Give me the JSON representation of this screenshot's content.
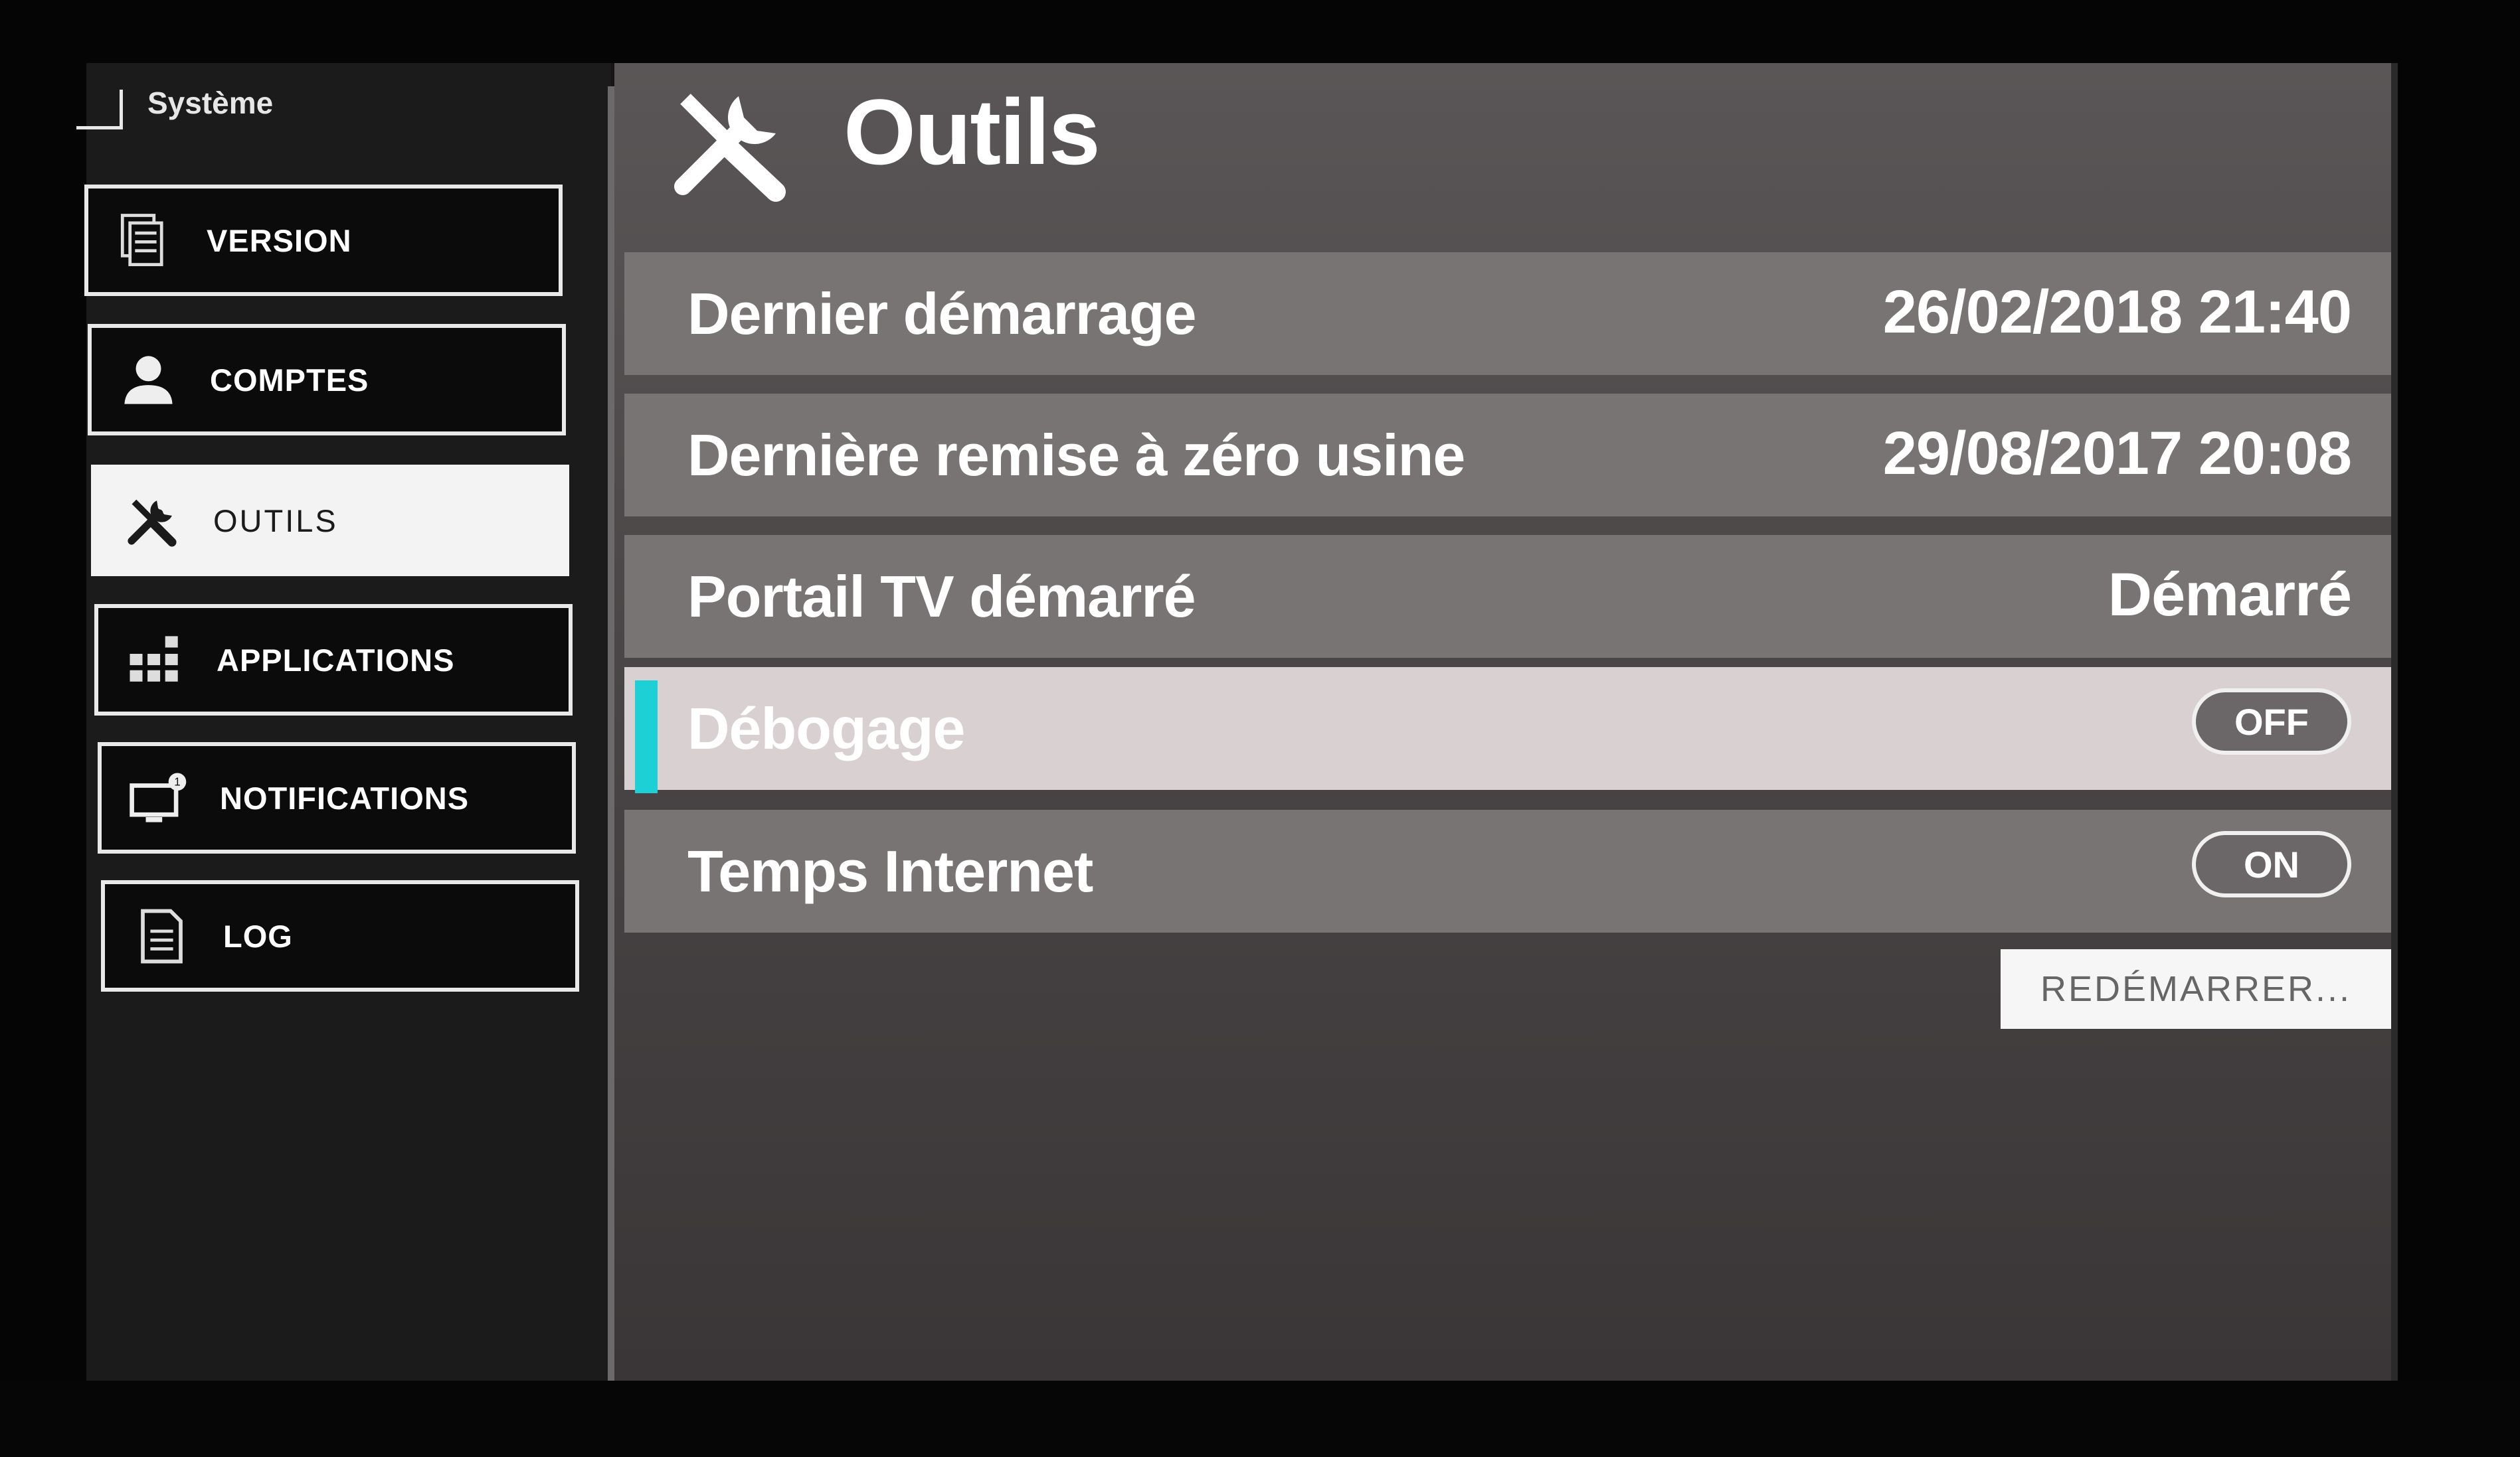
{
  "sidebar": {
    "section_title": "Système",
    "items": [
      {
        "label": "VERSION",
        "icon": "document-stack-icon"
      },
      {
        "label": "COMPTES",
        "icon": "user-icon"
      },
      {
        "label": "OUTILS",
        "icon": "tools-icon",
        "active": true
      },
      {
        "label": "APPLICATIONS",
        "icon": "apps-grid-icon"
      },
      {
        "label": "NOTIFICATIONS",
        "icon": "notification-monitor-icon"
      },
      {
        "label": "LOG",
        "icon": "log-document-icon"
      }
    ]
  },
  "main": {
    "title": "Outils",
    "title_icon": "tools-icon",
    "rows": [
      {
        "label": "Dernier démarrage",
        "value": "26/02/2018 21:40"
      },
      {
        "label": "Dernière remise à zéro usine",
        "value": "29/08/2017 20:08"
      },
      {
        "label": "Portail TV démarré",
        "value": "Démarré"
      },
      {
        "label": "Débogage",
        "toggle": "OFF",
        "focused": true
      },
      {
        "label": "Temps Internet",
        "toggle": "ON"
      }
    ],
    "restart_label": "REDÉMARRER..."
  },
  "colors": {
    "focus_accent": "#1dd0d6",
    "row_background": "#787474",
    "focused_row_background": "#d9d0d2"
  }
}
